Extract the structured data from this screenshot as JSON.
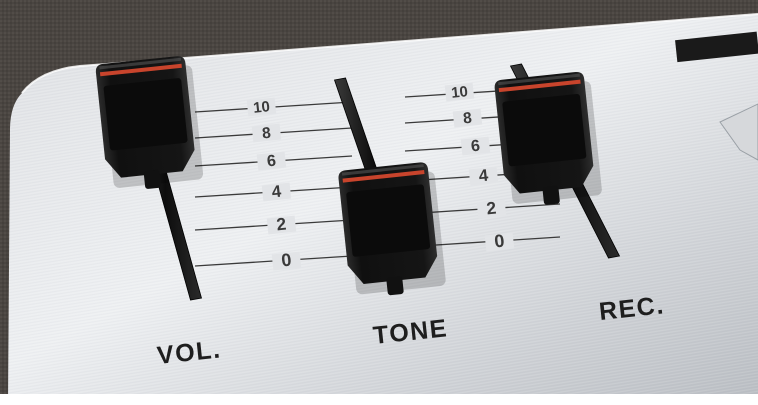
{
  "panel": {
    "surface": "brushed-aluminium",
    "surround": "dark-fabric",
    "colors": {
      "fabric": "#4a4541",
      "panel_light": "#e9eaec",
      "panel_mid": "#c9ccd0",
      "panel_dark": "#a9adb2",
      "scale_text": "#3a3a3a",
      "label_text": "#1e1e1e",
      "knob": "#141414",
      "knob_stripe": "#c8442c"
    }
  },
  "scale": {
    "marks": [
      "10",
      "8",
      "6",
      "4",
      "2",
      "0"
    ]
  },
  "sliders": [
    {
      "id": "vol",
      "label": "VOL.",
      "level": 0.97
    },
    {
      "id": "tone",
      "label": "TONE",
      "level": 0.42
    },
    {
      "id": "rec",
      "label": "REC.",
      "level": 0.8
    }
  ]
}
